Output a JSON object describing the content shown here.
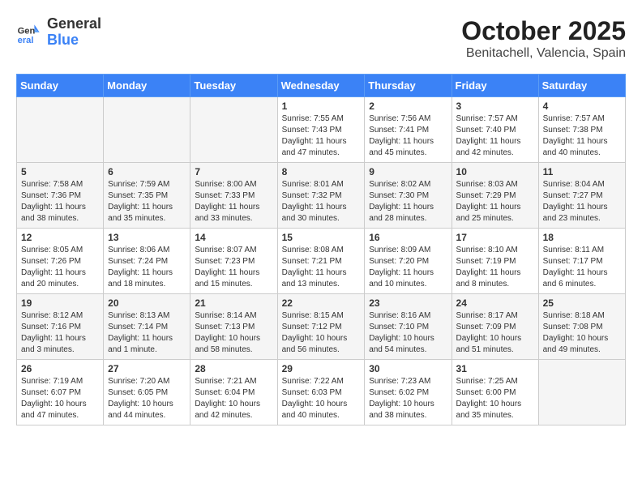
{
  "header": {
    "logo_general": "General",
    "logo_blue": "Blue",
    "month": "October 2025",
    "location": "Benitachell, Valencia, Spain"
  },
  "weekdays": [
    "Sunday",
    "Monday",
    "Tuesday",
    "Wednesday",
    "Thursday",
    "Friday",
    "Saturday"
  ],
  "weeks": [
    [
      {
        "day": "",
        "content": "",
        "empty": true
      },
      {
        "day": "",
        "content": "",
        "empty": true
      },
      {
        "day": "",
        "content": "",
        "empty": true
      },
      {
        "day": "1",
        "content": "Sunrise: 7:55 AM\nSunset: 7:43 PM\nDaylight: 11 hours and 47 minutes.",
        "empty": false
      },
      {
        "day": "2",
        "content": "Sunrise: 7:56 AM\nSunset: 7:41 PM\nDaylight: 11 hours and 45 minutes.",
        "empty": false
      },
      {
        "day": "3",
        "content": "Sunrise: 7:57 AM\nSunset: 7:40 PM\nDaylight: 11 hours and 42 minutes.",
        "empty": false
      },
      {
        "day": "4",
        "content": "Sunrise: 7:57 AM\nSunset: 7:38 PM\nDaylight: 11 hours and 40 minutes.",
        "empty": false
      }
    ],
    [
      {
        "day": "5",
        "content": "Sunrise: 7:58 AM\nSunset: 7:36 PM\nDaylight: 11 hours and 38 minutes.",
        "empty": false
      },
      {
        "day": "6",
        "content": "Sunrise: 7:59 AM\nSunset: 7:35 PM\nDaylight: 11 hours and 35 minutes.",
        "empty": false
      },
      {
        "day": "7",
        "content": "Sunrise: 8:00 AM\nSunset: 7:33 PM\nDaylight: 11 hours and 33 minutes.",
        "empty": false
      },
      {
        "day": "8",
        "content": "Sunrise: 8:01 AM\nSunset: 7:32 PM\nDaylight: 11 hours and 30 minutes.",
        "empty": false
      },
      {
        "day": "9",
        "content": "Sunrise: 8:02 AM\nSunset: 7:30 PM\nDaylight: 11 hours and 28 minutes.",
        "empty": false
      },
      {
        "day": "10",
        "content": "Sunrise: 8:03 AM\nSunset: 7:29 PM\nDaylight: 11 hours and 25 minutes.",
        "empty": false
      },
      {
        "day": "11",
        "content": "Sunrise: 8:04 AM\nSunset: 7:27 PM\nDaylight: 11 hours and 23 minutes.",
        "empty": false
      }
    ],
    [
      {
        "day": "12",
        "content": "Sunrise: 8:05 AM\nSunset: 7:26 PM\nDaylight: 11 hours and 20 minutes.",
        "empty": false
      },
      {
        "day": "13",
        "content": "Sunrise: 8:06 AM\nSunset: 7:24 PM\nDaylight: 11 hours and 18 minutes.",
        "empty": false
      },
      {
        "day": "14",
        "content": "Sunrise: 8:07 AM\nSunset: 7:23 PM\nDaylight: 11 hours and 15 minutes.",
        "empty": false
      },
      {
        "day": "15",
        "content": "Sunrise: 8:08 AM\nSunset: 7:21 PM\nDaylight: 11 hours and 13 minutes.",
        "empty": false
      },
      {
        "day": "16",
        "content": "Sunrise: 8:09 AM\nSunset: 7:20 PM\nDaylight: 11 hours and 10 minutes.",
        "empty": false
      },
      {
        "day": "17",
        "content": "Sunrise: 8:10 AM\nSunset: 7:19 PM\nDaylight: 11 hours and 8 minutes.",
        "empty": false
      },
      {
        "day": "18",
        "content": "Sunrise: 8:11 AM\nSunset: 7:17 PM\nDaylight: 11 hours and 6 minutes.",
        "empty": false
      }
    ],
    [
      {
        "day": "19",
        "content": "Sunrise: 8:12 AM\nSunset: 7:16 PM\nDaylight: 11 hours and 3 minutes.",
        "empty": false
      },
      {
        "day": "20",
        "content": "Sunrise: 8:13 AM\nSunset: 7:14 PM\nDaylight: 11 hours and 1 minute.",
        "empty": false
      },
      {
        "day": "21",
        "content": "Sunrise: 8:14 AM\nSunset: 7:13 PM\nDaylight: 10 hours and 58 minutes.",
        "empty": false
      },
      {
        "day": "22",
        "content": "Sunrise: 8:15 AM\nSunset: 7:12 PM\nDaylight: 10 hours and 56 minutes.",
        "empty": false
      },
      {
        "day": "23",
        "content": "Sunrise: 8:16 AM\nSunset: 7:10 PM\nDaylight: 10 hours and 54 minutes.",
        "empty": false
      },
      {
        "day": "24",
        "content": "Sunrise: 8:17 AM\nSunset: 7:09 PM\nDaylight: 10 hours and 51 minutes.",
        "empty": false
      },
      {
        "day": "25",
        "content": "Sunrise: 8:18 AM\nSunset: 7:08 PM\nDaylight: 10 hours and 49 minutes.",
        "empty": false
      }
    ],
    [
      {
        "day": "26",
        "content": "Sunrise: 7:19 AM\nSunset: 6:07 PM\nDaylight: 10 hours and 47 minutes.",
        "empty": false
      },
      {
        "day": "27",
        "content": "Sunrise: 7:20 AM\nSunset: 6:05 PM\nDaylight: 10 hours and 44 minutes.",
        "empty": false
      },
      {
        "day": "28",
        "content": "Sunrise: 7:21 AM\nSunset: 6:04 PM\nDaylight: 10 hours and 42 minutes.",
        "empty": false
      },
      {
        "day": "29",
        "content": "Sunrise: 7:22 AM\nSunset: 6:03 PM\nDaylight: 10 hours and 40 minutes.",
        "empty": false
      },
      {
        "day": "30",
        "content": "Sunrise: 7:23 AM\nSunset: 6:02 PM\nDaylight: 10 hours and 38 minutes.",
        "empty": false
      },
      {
        "day": "31",
        "content": "Sunrise: 7:25 AM\nSunset: 6:00 PM\nDaylight: 10 hours and 35 minutes.",
        "empty": false
      },
      {
        "day": "",
        "content": "",
        "empty": true
      }
    ]
  ]
}
